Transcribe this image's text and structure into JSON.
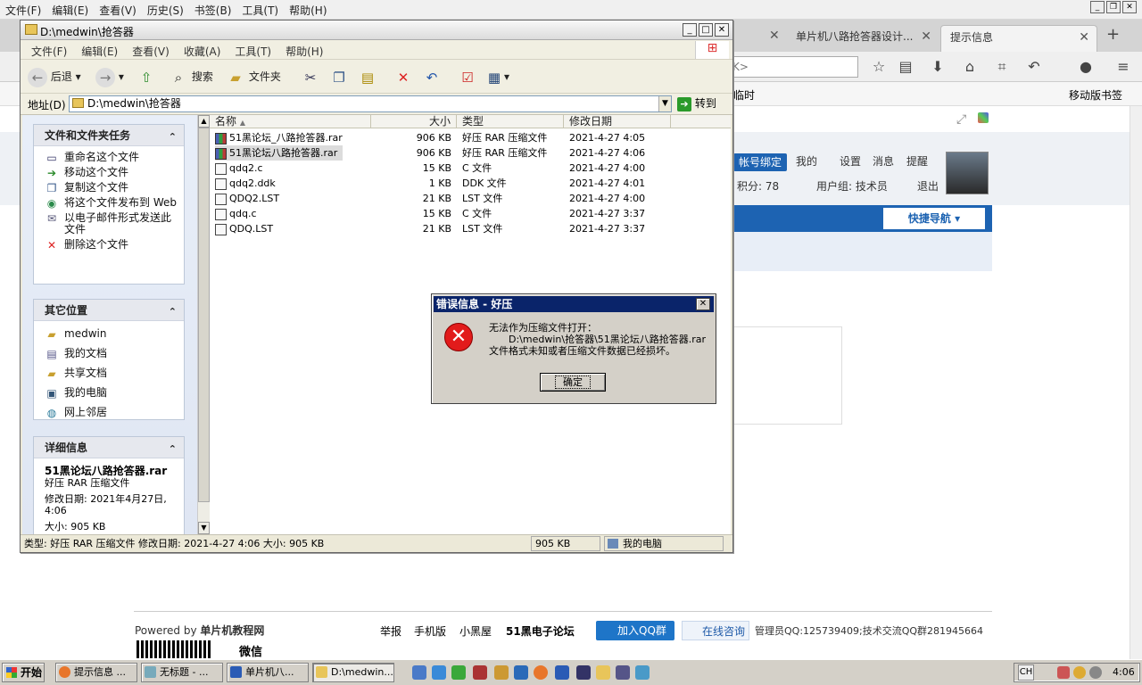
{
  "firefox": {
    "menu": [
      "文件(F)",
      "编辑(E)",
      "查看(V)",
      "历史(S)",
      "书签(B)",
      "工具(T)",
      "帮助(H)"
    ],
    "tabs": [
      {
        "label": "单片机八路抢答器设计..."
      },
      {
        "label": "提示信息"
      }
    ],
    "url_fragment": "K>",
    "bookmark_partial": "临时",
    "mobile_bookmarks": "移动版书签"
  },
  "webpage": {
    "user_bind": "帐号绑定",
    "my": "我的",
    "settings": "设置",
    "messages": "消息",
    "remind": "提醒",
    "points": "积分: 78",
    "usergroup": "用户组: 技术员",
    "logout": "退出",
    "quicknav": "快捷导航",
    "footer": {
      "powered": "Powered by",
      "site": "单片机教程网",
      "wechat": "微信",
      "links": [
        "举报",
        "手机版",
        "小黑屋"
      ],
      "brand": "51黑电子论坛",
      "qq_group_btn": "加入QQ群",
      "online": "在线咨询",
      "admin": "管理员QQ:125739409;技术交流QQ群281945664"
    }
  },
  "explorer": {
    "title": "D:\\medwin\\抢答器",
    "menu": [
      "文件(F)",
      "编辑(E)",
      "查看(V)",
      "收藏(A)",
      "工具(T)",
      "帮助(H)"
    ],
    "toolbar": {
      "back": "后退",
      "search": "搜索",
      "folders": "文件夹"
    },
    "address_label": "地址(D)",
    "address": "D:\\medwin\\抢答器",
    "go": "转到",
    "tasks_panel": {
      "title": "文件和文件夹任务",
      "items": [
        "重命名这个文件",
        "移动这个文件",
        "复制这个文件",
        "将这个文件发布到 Web",
        "以电子邮件形式发送此文件",
        "删除这个文件"
      ]
    },
    "places_panel": {
      "title": "其它位置",
      "items": [
        "medwin",
        "我的文档",
        "共享文档",
        "我的电脑",
        "网上邻居"
      ]
    },
    "details_panel": {
      "title": "详细信息",
      "name": "51黑论坛八路抢答器.rar",
      "type": "好压 RAR 压缩文件",
      "modified": "修改日期: 2021年4月27日, 4:06",
      "size": "大小: 905 KB"
    },
    "columns": [
      "名称",
      "大小",
      "类型",
      "修改日期"
    ],
    "files": [
      {
        "name": "51黑论坛_八路抢答器.rar",
        "size": "906 KB",
        "type": "好压 RAR 压缩文件",
        "date": "2021-4-27 4:05",
        "icon": "rar"
      },
      {
        "name": "51黑论坛八路抢答器.rar",
        "size": "906 KB",
        "type": "好压 RAR 压缩文件",
        "date": "2021-4-27 4:06",
        "icon": "rar"
      },
      {
        "name": "qdq2.c",
        "size": "15 KB",
        "type": "C 文件",
        "date": "2021-4-27 4:00",
        "icon": "c"
      },
      {
        "name": "qdq2.ddk",
        "size": "1 KB",
        "type": "DDK 文件",
        "date": "2021-4-27 4:01",
        "icon": "ddk"
      },
      {
        "name": "QDQ2.LST",
        "size": "21 KB",
        "type": "LST 文件",
        "date": "2021-4-27 4:00",
        "icon": "lst"
      },
      {
        "name": "qdq.c",
        "size": "15 KB",
        "type": "C 文件",
        "date": "2021-4-27 3:37",
        "icon": "c"
      },
      {
        "name": "QDQ.LST",
        "size": "21 KB",
        "type": "LST 文件",
        "date": "2021-4-27 3:37",
        "icon": "lst"
      }
    ],
    "status": {
      "info": "类型: 好压 RAR 压缩文件 修改日期: 2021-4-27 4:06 大小: 905 KB",
      "size": "905 KB",
      "location": "我的电脑"
    }
  },
  "dialog": {
    "title": "错误信息 - 好压",
    "line1": "无法作为压缩文件打开：",
    "line2": "D:\\medwin\\抢答器\\51黑论坛八路抢答器.rar",
    "line3": "文件格式未知或者压缩文件数据已经损坏。",
    "ok": "确定"
  },
  "taskbar": {
    "start": "开始",
    "tasks": [
      "提示信息 ...",
      "无标题 - ...",
      "单片机八...",
      "D:\\medwin..."
    ],
    "lang": "CH",
    "time": "4:06"
  }
}
